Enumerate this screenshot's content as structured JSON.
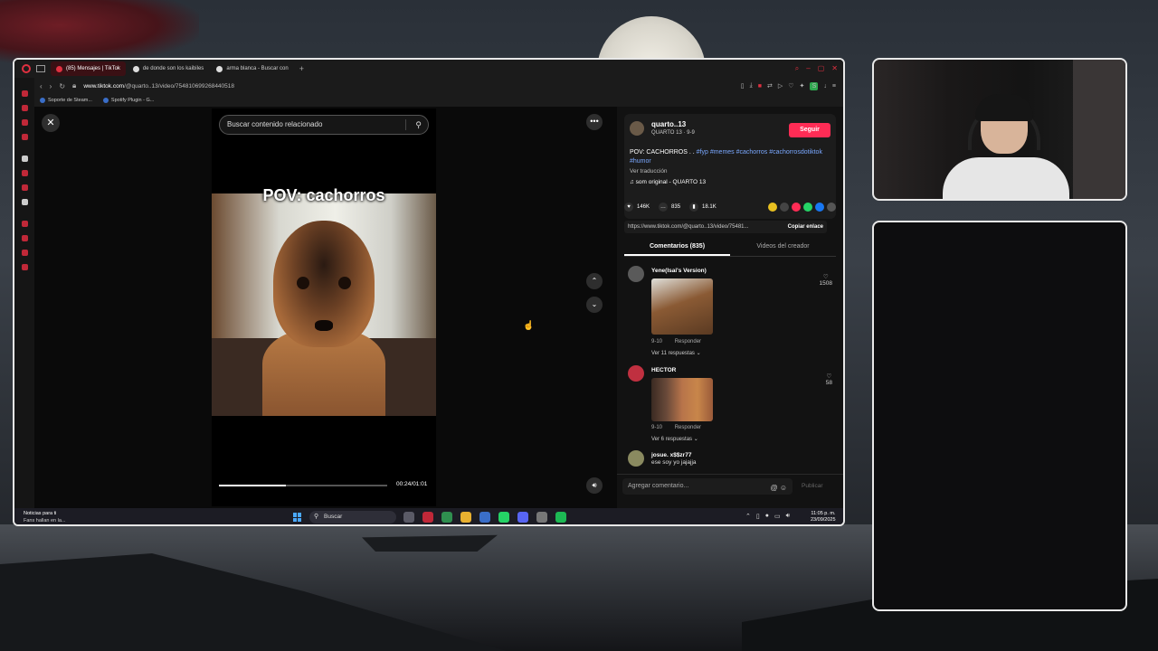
{
  "browser": {
    "tabs": [
      {
        "label": "(85) Mensajes | TikTok",
        "active": true
      },
      {
        "label": "de donde son los kaibiles",
        "active": false
      },
      {
        "label": "arma blanca - Buscar con",
        "active": false
      }
    ],
    "new_tab": "+",
    "url_host": "www.tiktok.com",
    "url_path": "/@quarto..13/video/754810699268440518",
    "bookmarks": [
      "Soporte de Steam...",
      "Spotify Plugin - G..."
    ]
  },
  "tiktok": {
    "search_placeholder": "Buscar contenido relacionado",
    "video": {
      "caption": "POV: cachorros",
      "time": "00:24/01:01",
      "progress": 0.4
    },
    "author": {
      "name": "quarto..13",
      "sub": "QUARTO 13 · 9-9",
      "follow_label": "Seguir",
      "desc_text": "POV: CACHORROS . .",
      "desc_tags": "#fyp #memes #cachorros #cachorrosdotiktok #humor",
      "translate": "Ver traducción",
      "sound": "♫ som original - QUARTO 13"
    },
    "stats": {
      "likes": "146K",
      "comments": "835",
      "saves": "18.1K"
    },
    "link": {
      "url": "https://www.tiktok.com/@quarto..13/video/75481...",
      "copy_label": "Copiar enlace"
    },
    "tabs": {
      "comments": "Comentarios (835)",
      "creator_videos": "Videos del creador"
    },
    "comments": [
      {
        "name": "Yene(Isai's Version)",
        "date": "9-10",
        "reply": "Responder",
        "replies": "Ver 11 respuestas ⌄",
        "likes": "1508"
      },
      {
        "name": "HECTOR",
        "date": "9-10",
        "reply": "Responder",
        "replies": "Ver 6 respuestas ⌄",
        "likes": "58"
      },
      {
        "name": "josue. x$$zr77",
        "text": "ese soy yo jajajja"
      }
    ],
    "comment_input": {
      "placeholder": "Agregar comentario...",
      "post_label": "Publicar"
    }
  },
  "taskbar": {
    "news_title": "Noticias para ti",
    "news_sub": "Fans hallan en la...",
    "search_label": "Buscar",
    "time": "11:05 p. m.",
    "date": "23/09/2025"
  },
  "icons": {
    "close": "close-icon",
    "search": "search-icon",
    "more": "more-icon",
    "up": "chevron-up-icon",
    "down": "chevron-down-icon",
    "volume": "volume-icon",
    "heart": "heart-icon",
    "comment": "comment-icon",
    "bookmark": "bookmark-icon"
  },
  "colors": {
    "accent": "#fe2c55",
    "tag": "#7aa8ff",
    "opera": "#e03040"
  }
}
